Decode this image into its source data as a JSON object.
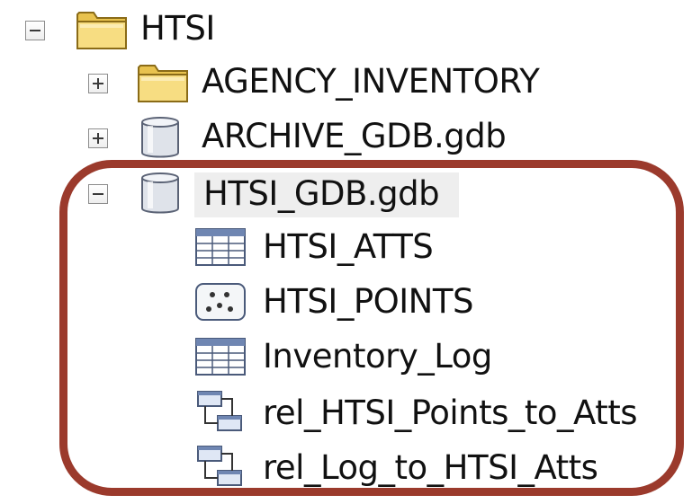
{
  "tree": {
    "root": {
      "label": "HTSI",
      "icon": "folder-icon",
      "state": "expanded"
    },
    "children": [
      {
        "label": "AGENCY_INVENTORY",
        "icon": "folder-icon",
        "state": "collapsed"
      },
      {
        "label": "ARCHIVE_GDB.gdb",
        "icon": "geodatabase-icon",
        "state": "collapsed"
      },
      {
        "label": "HTSI_GDB.gdb",
        "icon": "geodatabase-icon",
        "state": "expanded",
        "selected": true
      }
    ],
    "gdb_items": [
      {
        "label": "HTSI_ATTS",
        "icon": "table-icon"
      },
      {
        "label": "HTSI_POINTS",
        "icon": "point-feature-class-icon"
      },
      {
        "label": "Inventory_Log",
        "icon": "table-icon"
      },
      {
        "label": "rel_HTSI_Points_to_Atts",
        "icon": "relationship-class-icon"
      },
      {
        "label": "rel_Log_to_HTSI_Atts",
        "icon": "relationship-class-icon"
      }
    ]
  },
  "colors": {
    "highlight": "#9b3a2c",
    "folder": "#f2d36b",
    "selection": "#eeeeee"
  }
}
